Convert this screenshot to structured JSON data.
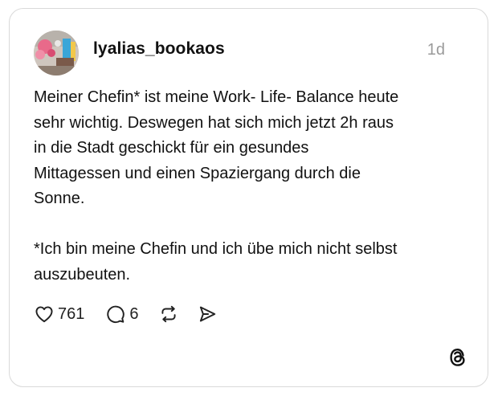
{
  "post": {
    "username": "lyalias_bookaos",
    "time": "1d",
    "text_paragraph_1": "Meiner Chefin* ist meine Work- Life- Balance heute\nsehr wichtig. Deswegen hat sich mich jetzt 2h raus\nin die Stadt geschickt für ein gesundes\nMittagessen und einen Spaziergang durch die\nSonne.",
    "text_paragraph_2": "*Ich bin meine Chefin und ich übe mich nicht selbst\nauszubeuten.",
    "likes": "761",
    "replies": "6"
  },
  "icons": {
    "like": "heart-icon",
    "reply": "comment-bubble-icon",
    "repost": "repost-icon",
    "share": "send-icon",
    "brand": "threads-logo-icon"
  },
  "colors": {
    "text": "#111111",
    "muted": "#9a9a9a",
    "border": "#d9d9d9",
    "background": "#ffffff"
  }
}
